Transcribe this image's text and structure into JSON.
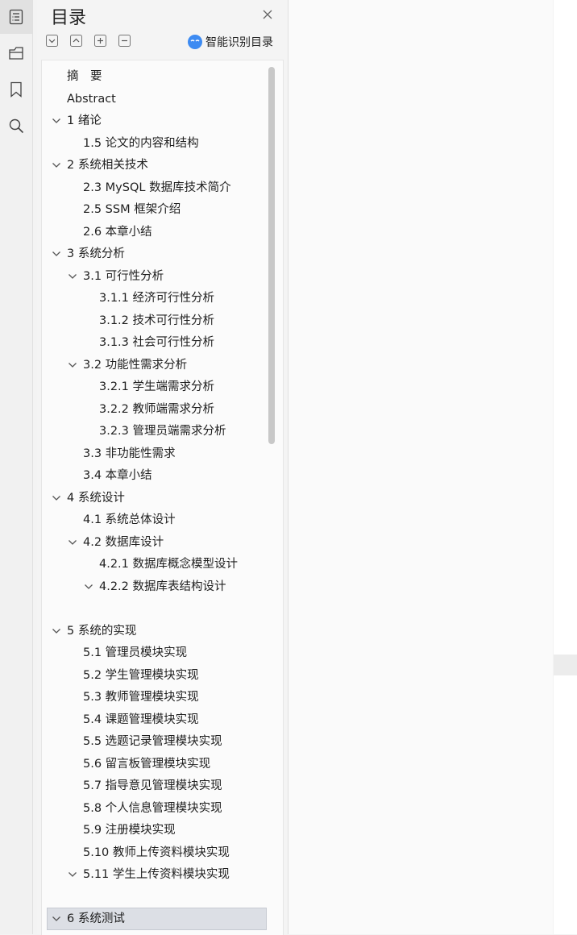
{
  "panel": {
    "title": "目录",
    "smart_toc_label": "智能识别目录"
  },
  "toolbar": {
    "icons": [
      "collapse-icon",
      "expand-icon",
      "add-icon",
      "remove-icon"
    ]
  },
  "sidebar_icons": [
    "toc-icon",
    "outline-icon",
    "bookmark-icon",
    "search-icon"
  ],
  "toc": [
    {
      "label": "摘　要",
      "level": 0,
      "chevron": false
    },
    {
      "label": "Abstract",
      "level": 0,
      "chevron": false
    },
    {
      "label": "1  绪论",
      "level": 0,
      "chevron": true
    },
    {
      "label": "1.5 论文的内容和结构",
      "level": 1,
      "chevron": false
    },
    {
      "label": "2  系统相关技术",
      "level": 0,
      "chevron": true
    },
    {
      "label": "2.3 MySQL 数据库技术简介",
      "level": 1,
      "chevron": false
    },
    {
      "label": "2.5 SSM 框架介绍",
      "level": 1,
      "chevron": false
    },
    {
      "label": "2.6  本章小结",
      "level": 1,
      "chevron": false
    },
    {
      "label": "3 系统分析",
      "level": 0,
      "chevron": true
    },
    {
      "label": "3.1 可行性分析",
      "level": 1,
      "chevron": true
    },
    {
      "label": "3.1.1  经济可行性分析",
      "level": 2,
      "chevron": false
    },
    {
      "label": "3.1.2 技术可行性分析",
      "level": 2,
      "chevron": false
    },
    {
      "label": "3.1.3 社会可行性分析",
      "level": 2,
      "chevron": false
    },
    {
      "label": "3.2 功能性需求分析",
      "level": 1,
      "chevron": true
    },
    {
      "label": "3.2.1 学生端需求分析",
      "level": 2,
      "chevron": false
    },
    {
      "label": "3.2.2 教师端需求分析",
      "level": 2,
      "chevron": false
    },
    {
      "label": "3.2.3 管理员端需求分析",
      "level": 2,
      "chevron": false
    },
    {
      "label": "3.3  非功能性需求",
      "level": 1,
      "chevron": false
    },
    {
      "label": "3.4  本章小结",
      "level": 1,
      "chevron": false
    },
    {
      "label": "4  系统设计",
      "level": 0,
      "chevron": true
    },
    {
      "label": "4.1 系统总体设计",
      "level": 1,
      "chevron": false
    },
    {
      "label": "4.2 数据库设计",
      "level": 1,
      "chevron": true
    },
    {
      "label": "4.2.1  数据库概念模型设计",
      "level": 2,
      "chevron": false
    },
    {
      "label": "4.2.2  数据库表结构设计",
      "level": 2,
      "chevron": true
    },
    {
      "label": "",
      "level": 0,
      "chevron": false
    },
    {
      "label": "5 系统的实现",
      "level": 0,
      "chevron": true
    },
    {
      "label": "5.1 管理员模块实现",
      "level": 1,
      "chevron": false
    },
    {
      "label": "5.2 学生管理模块实现",
      "level": 1,
      "chevron": false
    },
    {
      "label": "5.3 教师管理模块实现",
      "level": 1,
      "chevron": false
    },
    {
      "label": "5.4  课题管理模块实现",
      "level": 1,
      "chevron": false
    },
    {
      "label": "5.5  选题记录管理模块实现",
      "level": 1,
      "chevron": false
    },
    {
      "label": "5.6  留言板管理模块实现",
      "level": 1,
      "chevron": false
    },
    {
      "label": "5.7  指导意见管理模块实现",
      "level": 1,
      "chevron": false
    },
    {
      "label": "5.8  个人信息管理模块实现",
      "level": 1,
      "chevron": false
    },
    {
      "label": "5.9 注册模块实现",
      "level": 1,
      "chevron": false
    },
    {
      "label": "5.10 教师上传资料模块实现",
      "level": 1,
      "chevron": false
    },
    {
      "label": "5.11 学生上传资料模块实现",
      "level": 1,
      "chevron": true
    },
    {
      "label": "",
      "level": 0,
      "chevron": false
    },
    {
      "label": "6 系统测试",
      "level": 0,
      "chevron": true,
      "selected": true
    }
  ]
}
